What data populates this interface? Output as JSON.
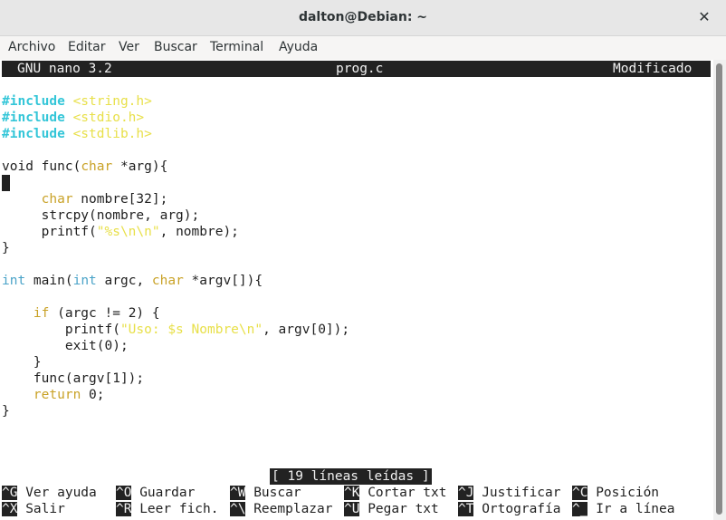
{
  "window": {
    "title": "dalton@Debian: ~",
    "close_glyph": "✕"
  },
  "menu": [
    "Archivo",
    "Editar",
    "Ver",
    "Buscar",
    "Terminal",
    "Ayuda"
  ],
  "nano": {
    "version": "GNU nano 3.2",
    "filename": "prog.c",
    "state": "Modificado",
    "status_message": "[ 19 líneas leídas ]"
  },
  "code": {
    "inc1_kw": "#include",
    "inc1_file": "<string.h>",
    "inc2_kw": "#include",
    "inc2_file": "<stdio.h>",
    "inc3_kw": "#include",
    "inc3_file": "<stdlib.h>",
    "func_a": "void func(",
    "func_type": "char",
    "func_b": " *arg){",
    "decl_type": "char",
    "decl_rest": " nombre[32];",
    "strcpy": "strcpy(nombre, arg);",
    "printf1_a": "printf(",
    "printf1_str": "\"%s\\n\\n\"",
    "printf1_b": ", nombre);",
    "close1": "}",
    "main_type1": "int",
    "main_a": " main(",
    "main_type2": "int",
    "main_b": " argc, ",
    "main_type3": "char",
    "main_c": " *argv[]){",
    "if_kw": "if",
    "if_rest": " (argc != 2) {",
    "printf2_a": "printf(",
    "printf2_str": "\"Uso: $s Nombre\\n\"",
    "printf2_b": ", argv[0]);",
    "exit": "exit(0);",
    "close2": "}",
    "funccall": "func(argv[1]);",
    "ret_kw": "return",
    "ret_rest": " 0;",
    "close3": "}"
  },
  "shortcuts": [
    {
      "key": "^G",
      "label": "Ver ayuda"
    },
    {
      "key": "^X",
      "label": "Salir"
    },
    {
      "key": "^O",
      "label": "Guardar"
    },
    {
      "key": "^R",
      "label": "Leer fich."
    },
    {
      "key": "^W",
      "label": "Buscar"
    },
    {
      "key": "^\\",
      "label": "Reemplazar"
    },
    {
      "key": "^K",
      "label": "Cortar txt"
    },
    {
      "key": "^U",
      "label": "Pegar txt"
    },
    {
      "key": "^J",
      "label": "Justificar"
    },
    {
      "key": "^T",
      "label": "Ortografía"
    },
    {
      "key": "^C",
      "label": "Posición"
    },
    {
      "key": "^_",
      "label": "Ir a línea"
    }
  ]
}
